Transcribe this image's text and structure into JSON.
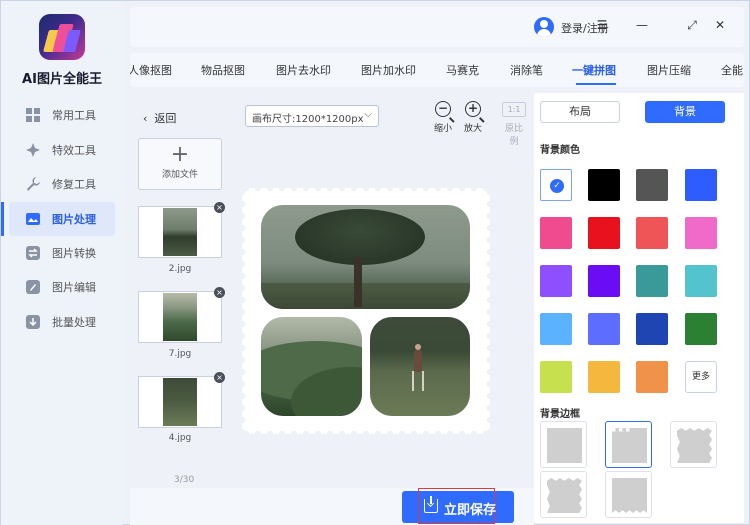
{
  "app": {
    "title": "AI图片全能王"
  },
  "sidebar": {
    "items": [
      {
        "label": "常用工具",
        "icon": "grid-icon"
      },
      {
        "label": "特效工具",
        "icon": "sparkle-icon"
      },
      {
        "label": "修复工具",
        "icon": "wrench-icon"
      },
      {
        "label": "图片处理",
        "icon": "image-process-icon",
        "active": true
      },
      {
        "label": "图片转换",
        "icon": "convert-icon"
      },
      {
        "label": "图片编辑",
        "icon": "edit-icon"
      },
      {
        "label": "批量处理",
        "icon": "batch-icon"
      }
    ]
  },
  "header": {
    "login_label": "登录/注册",
    "window_controls": [
      "menu-icon",
      "minimize-icon",
      "maximize-icon",
      "close-icon"
    ]
  },
  "tabs": [
    {
      "label": "人像抠图"
    },
    {
      "label": "物品抠图"
    },
    {
      "label": "图片去水印"
    },
    {
      "label": "图片加水印"
    },
    {
      "label": "马赛克"
    },
    {
      "label": "消除笔"
    },
    {
      "label": "一键拼图",
      "active": true
    },
    {
      "label": "图片压缩"
    },
    {
      "label": "全能"
    }
  ],
  "toolbar": {
    "back_label": "返回",
    "canvas_size": "画布尺寸:1200*1200px",
    "zoom_out_label": "缩小",
    "zoom_in_label": "放大",
    "ratio_button": "1:1",
    "ratio_label": "原比例"
  },
  "files": {
    "add_label": "添加文件",
    "items": [
      {
        "name": "2.jpg"
      },
      {
        "name": "7.jpg"
      },
      {
        "name": "4.jpg"
      }
    ],
    "pager": "3/30"
  },
  "panel": {
    "tab_layout": "布局",
    "tab_background": "背景",
    "bg_color_title": "背景颜色",
    "colors": [
      "#ffffff",
      "#000000",
      "#555555",
      "#2f5cff",
      "#ef4b8e",
      "#e8121e",
      "#ef5557",
      "#f06ac9",
      "#8e4fff",
      "#6a0df5",
      "#3a9a9a",
      "#53c3cd",
      "#5bb2ff",
      "#5c6dff",
      "#1f45b3",
      "#2b8034",
      "#c7e04d",
      "#f5b83f",
      "#f0924a"
    ],
    "more_label": "更多",
    "bg_border_title": "背景边框"
  },
  "footer": {
    "save_label": "立即保存"
  },
  "theme": {
    "accent": "#2f6bff",
    "danger": "#e53935"
  }
}
